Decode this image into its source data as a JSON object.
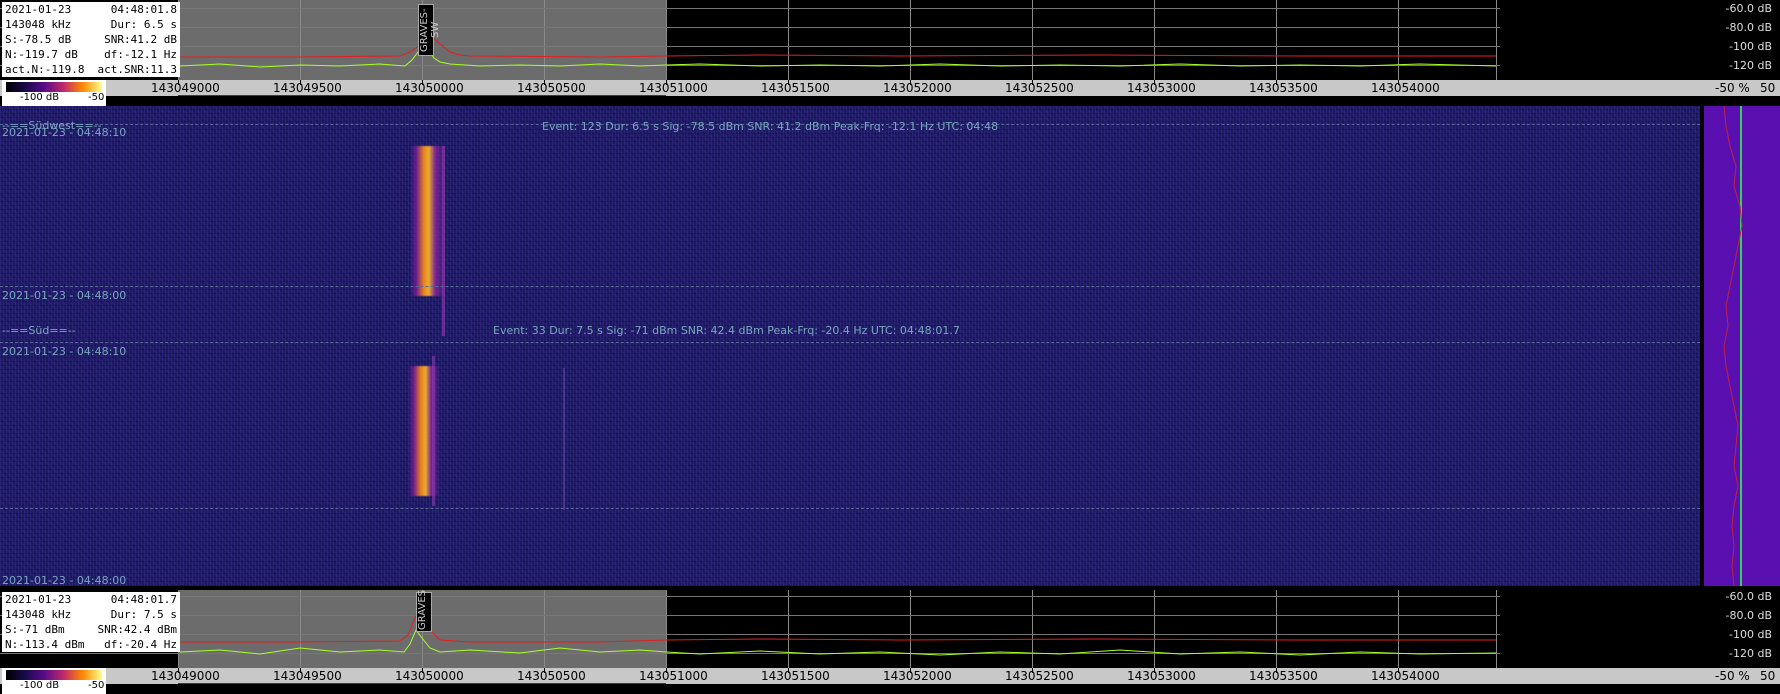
{
  "top_panel": {
    "info": [
      [
        "2021-01-23",
        "04:48:01.8"
      ],
      [
        "143048 kHz",
        "Dur: 6.5 s"
      ],
      [
        "S:-78.5 dB",
        "SNR:41.2 dB"
      ],
      [
        "N:-119.7 dB",
        "df:-12.1 Hz"
      ],
      [
        "act.N:-119.8",
        "act.SNR:11.3"
      ]
    ],
    "marker": "GRAVES-SW",
    "db_labels": [
      "-60.0 dB",
      "-80.0 dB",
      "-100 dB",
      "-120 dB"
    ]
  },
  "bottom_panel": {
    "info": [
      [
        "2021-01-23",
        "04:48:01.7"
      ],
      [
        "143048 kHz",
        "Dur: 7.5 s"
      ],
      [
        "S:-71 dBm",
        "SNR:42.4 dBm"
      ],
      [
        "N:-113.4 dBm",
        "df:-20.4 Hz"
      ]
    ],
    "marker": "GRAVES",
    "db_labels": [
      "-60.0 dB",
      "-80.0 dB",
      "-100 dB",
      "-120 dB"
    ]
  },
  "axis": {
    "unit_fragment": "Hz",
    "ticks": [
      "143049000",
      "143049500",
      "143050000",
      "143050500",
      "143051000",
      "143051500",
      "143052000",
      "143052500",
      "143053000",
      "143053500",
      "143054000"
    ],
    "percent_label": "-50 %",
    "percent_value": "50"
  },
  "color_scale": {
    "min": "-100 dB",
    "max": "-50"
  },
  "waterfall": {
    "section1": {
      "station": "--==Südwest==--",
      "time_top": "2021-01-23 - 04:48:10",
      "time_bottom": "2021-01-23 - 04:48:00",
      "event": "Event: 123   Dur: 6.5 s   Sig: -78.5 dBm   SNR: 41.2 dBm   Peak-Frq: -12.1 Hz   UTC: 04:48"
    },
    "section2": {
      "station": "--==Süd==--",
      "time_top": "2021-01-23 - 04:48:10",
      "time_bottom": "2021-01-23 - 04:48:00",
      "event": "Event: 33   Dur: 7.5 s   Sig: -71 dBm   SNR: 42.4 dBm   Peak-Frq: -20.4 Hz   UTC: 04:48:01.7"
    }
  },
  "colors": {
    "trace_green": "#a8ff2a",
    "trace_red": "#e02020",
    "highlight_gray": "#6c6c6c",
    "waterfall_bg": "#1e1a62"
  }
}
